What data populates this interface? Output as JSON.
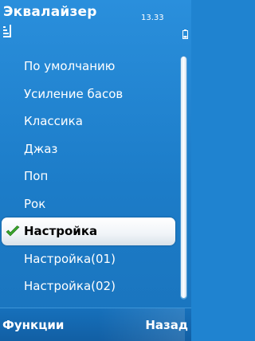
{
  "status_bar": {
    "title": "Эквалайзер",
    "time": "13.33",
    "signal_icon": "signal-icon",
    "battery_icon": "battery-icon"
  },
  "presets": {
    "items": [
      {
        "label": "По умолчанию"
      },
      {
        "label": "Усиление басов"
      },
      {
        "label": "Классика"
      },
      {
        "label": "Джаз"
      },
      {
        "label": "Поп"
      },
      {
        "label": "Рок"
      },
      {
        "label": "Настройка",
        "selected": true,
        "icon": "checkmark-icon"
      },
      {
        "label": "Настройка(01)"
      },
      {
        "label": "Настройка(02)"
      }
    ]
  },
  "softkeys": {
    "left": "Функции",
    "right": "Назад"
  },
  "colors": {
    "background": "#1f83d0",
    "selection": "#ffffff",
    "check": "#3aa62b"
  }
}
